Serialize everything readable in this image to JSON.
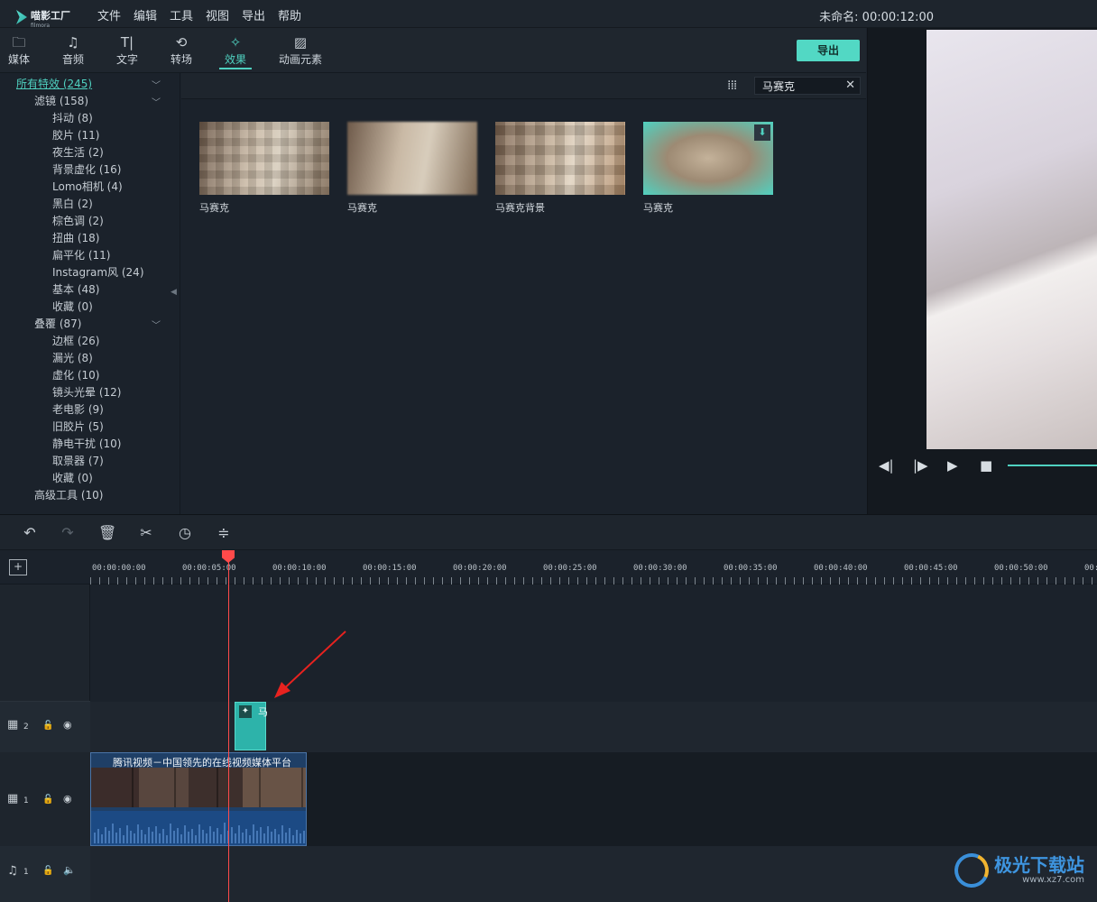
{
  "app": {
    "logo_text": "喵影工厂",
    "logo_sub": "filmora",
    "menu": [
      "文件",
      "编辑",
      "工具",
      "视图",
      "导出",
      "帮助"
    ],
    "project_title": "未命名: 00:00:12:00"
  },
  "tabs": [
    {
      "label": "媒体",
      "icon": "folder-icon"
    },
    {
      "label": "音频",
      "icon": "music-note-icon"
    },
    {
      "label": "文字",
      "icon": "text-icon"
    },
    {
      "label": "转场",
      "icon": "transition-icon"
    },
    {
      "label": "效果",
      "icon": "effects-icon",
      "active": true
    },
    {
      "label": "动画元素",
      "icon": "image-icon"
    }
  ],
  "export_label": "导出",
  "tree": {
    "all": "所有特效 (245)",
    "filters": "滤镜 (158)",
    "filter_items": [
      "抖动 (8)",
      "胶片 (11)",
      "夜生活 (2)",
      "背景虚化 (16)",
      "Lomo相机 (4)",
      "黑白 (2)",
      "棕色调 (2)",
      "扭曲 (18)",
      "扁平化 (11)",
      "Instagram风 (24)",
      "基本 (48)",
      "收藏 (0)"
    ],
    "overlays": "叠覆 (87)",
    "overlay_items": [
      "边框 (26)",
      "漏光 (8)",
      "虚化 (10)",
      "镜头光晕 (12)",
      "老电影 (9)",
      "旧胶片 (5)",
      "静电干扰 (10)",
      "取景器 (7)",
      "收藏 (0)"
    ],
    "advanced": "高级工具 (10)"
  },
  "search": {
    "value": "马赛克",
    "placeholder": ""
  },
  "effects": [
    {
      "label": "马赛克"
    },
    {
      "label": "马赛克"
    },
    {
      "label": "马赛克背景"
    },
    {
      "label": "马赛克",
      "downloadable": true
    }
  ],
  "timeline": {
    "ticks": [
      "00:00:00:00",
      "00:00:05:00",
      "00:00:10:00",
      "00:00:15:00",
      "00:00:20:00",
      "00:00:25:00",
      "00:00:30:00",
      "00:00:35:00",
      "00:00:40:00",
      "00:00:45:00",
      "00:00:50:00",
      "00:0"
    ],
    "tracks": [
      {
        "type": "video",
        "number": "2"
      },
      {
        "type": "video",
        "number": "1"
      },
      {
        "type": "audio",
        "number": "1"
      }
    ],
    "effect_clip_label": "马",
    "video_clip_title": "腾讯视频－中国领先的在线视频媒体平台"
  },
  "watermark": {
    "text": "极光下载站",
    "url": "www.xz7.com"
  },
  "colors": {
    "accent": "#4fd1c0",
    "playhead": "#ff4a4a",
    "clip_video": "#1f3f66"
  }
}
